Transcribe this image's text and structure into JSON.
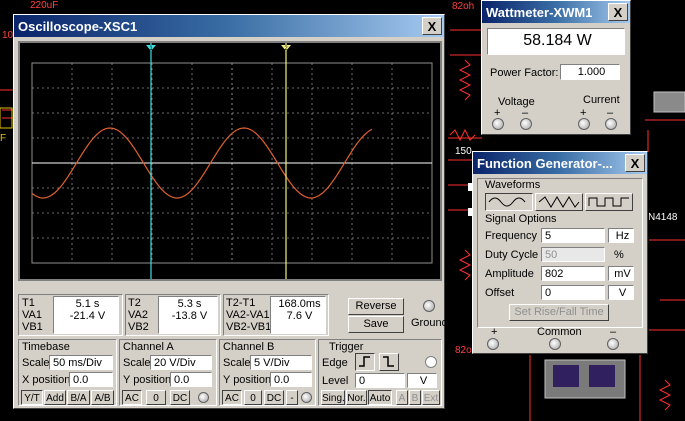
{
  "background": {
    "labels": [
      "220uF",
      "10",
      "F",
      "82oh",
      "150",
      "N4148",
      "82o"
    ]
  },
  "oscilloscope": {
    "title": "Oscilloscope-XSC1",
    "close": "X",
    "readouts": {
      "t1": {
        "label1": "T1",
        "label2": "VA1",
        "label3": "VB1",
        "time": "5.1 s",
        "va": "-21.4 V",
        "vb": ""
      },
      "t2": {
        "label1": "T2",
        "label2": "VA2",
        "label3": "VB2",
        "time": "5.3 s",
        "va": "-13.8 V",
        "vb": ""
      },
      "diff": {
        "label1": "T2-T1",
        "label2": "VA2-VA1",
        "label3": "VB2-VB1",
        "time": "168.0ms",
        "va": "7.6 V",
        "vb": ""
      }
    },
    "reverse_label": "Reverse",
    "save_label": "Save",
    "ground_label": "Ground",
    "timebase": {
      "title": "Timebase",
      "scale_label": "Scale",
      "scale_value": "50 ms/Div",
      "xpos_label": "X position",
      "xpos_value": "0.0",
      "modes": [
        "Y/T",
        "Add",
        "B/A",
        "A/B"
      ]
    },
    "channel_a": {
      "title": "Channel A",
      "scale_label": "Scale",
      "scale_value": "20 V/Div",
      "ypos_label": "Y position",
      "ypos_value": "0.0",
      "modes": [
        "AC",
        "0",
        "DC"
      ]
    },
    "channel_b": {
      "title": "Channel B",
      "scale_label": "Scale",
      "scale_value": "5 V/Div",
      "ypos_label": "Y position",
      "ypos_value": "0.0",
      "modes": [
        "AC",
        "0",
        "DC",
        "-"
      ]
    },
    "trigger": {
      "title": "Trigger",
      "edge_label": "Edge",
      "level_label": "Level",
      "level_value": "0",
      "level_unit": "V",
      "modes": [
        "Sing.",
        "Nor.",
        "Auto"
      ],
      "sources": [
        "A",
        "B",
        "Ext"
      ]
    },
    "cursors": {
      "c1_marker": "1",
      "c2_marker": "2"
    },
    "colors": {
      "trace": "#e06030",
      "cursor1": "#40e0e0",
      "cursor2": "#f0f080",
      "grid": "#909090"
    }
  },
  "wattmeter": {
    "title": "Wattmeter-XWM1",
    "close": "X",
    "reading": "58.184 W",
    "pf_label": "Power Factor:",
    "pf_value": "1.000",
    "voltage_label": "Voltage",
    "current_label": "Current",
    "plus": "+",
    "minus": "–"
  },
  "function_generator": {
    "title": "Function Generator-...",
    "close": "X",
    "waveforms_label": "Waveforms",
    "signal_options_label": "Signal Options",
    "frequency": {
      "label": "Frequency",
      "value": "5",
      "unit": "Hz"
    },
    "duty_cycle": {
      "label": "Duty Cycle",
      "value": "50",
      "unit": "%"
    },
    "amplitude": {
      "label": "Amplitude",
      "value": "802",
      "unit": "mV"
    },
    "offset": {
      "label": "Offset",
      "value": "0",
      "unit": "V"
    },
    "rise_fall_label": "Set Rise/Fall Time",
    "plus": "+",
    "common": "Common",
    "minus": "–"
  }
}
